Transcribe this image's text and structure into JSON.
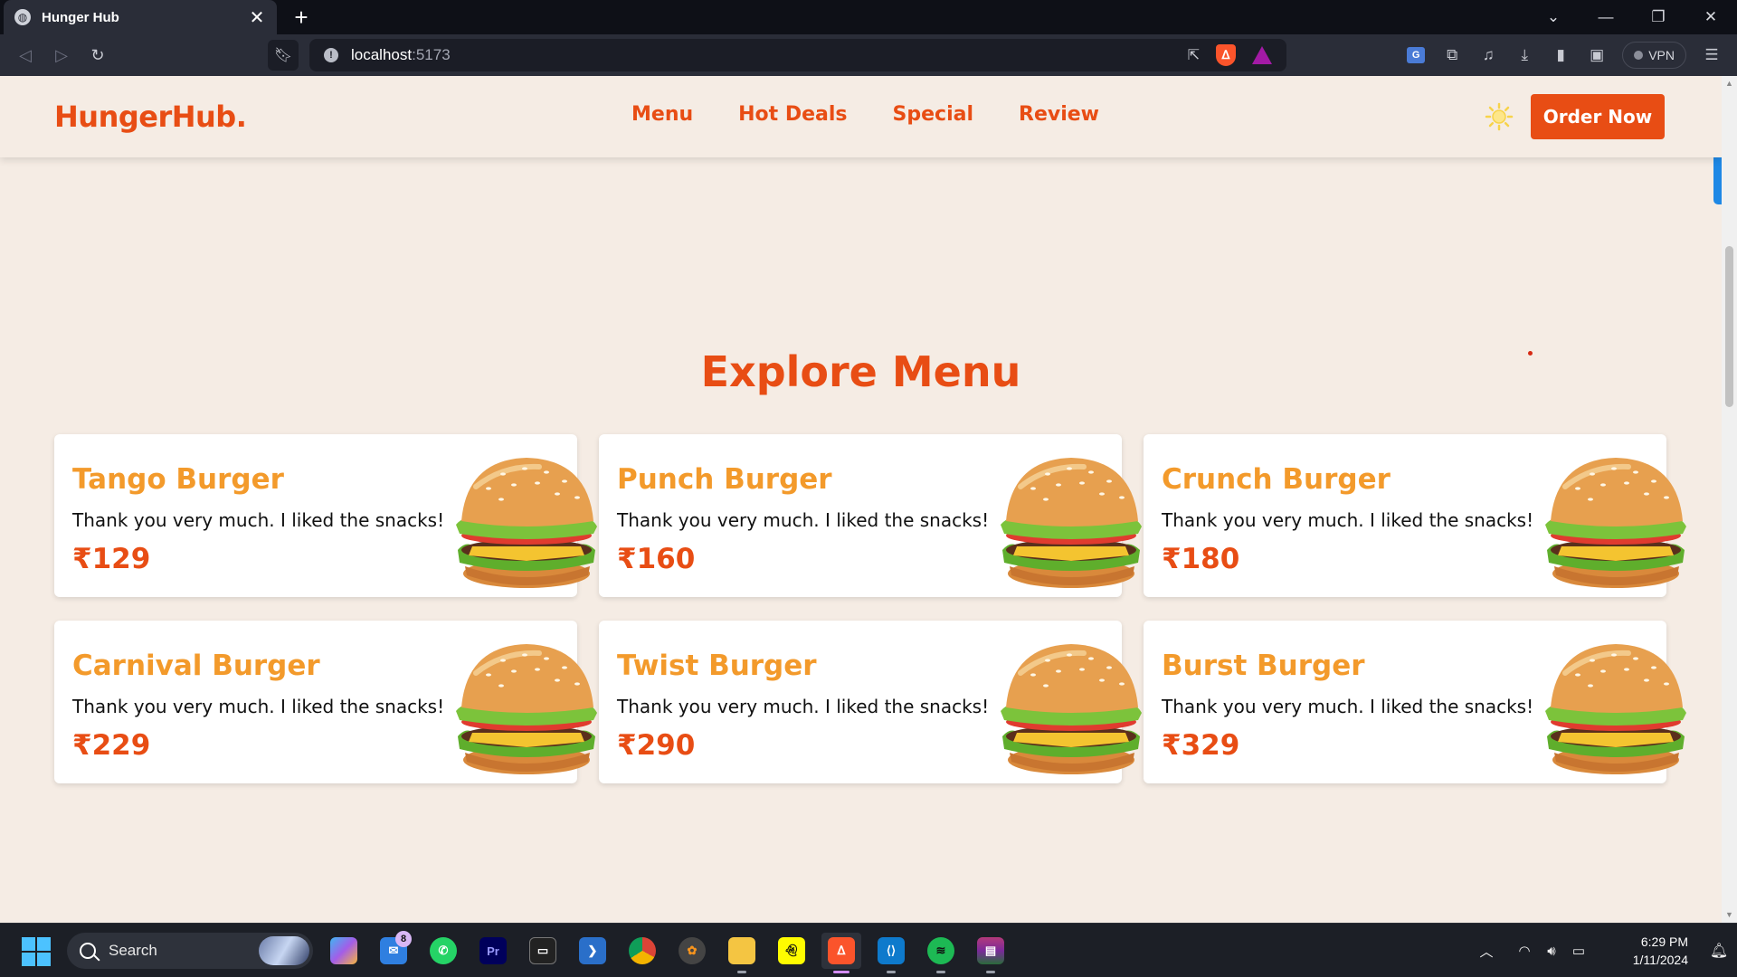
{
  "browser": {
    "tab_title": "Hunger Hub",
    "tab_close": "✕",
    "new_tab": "+",
    "url_host": "localhost",
    "url_port": ":5173",
    "vpn_label": "VPN"
  },
  "site": {
    "logo": "HungerHub.",
    "nav": [
      "Menu",
      "Hot Deals",
      "Special",
      "Review"
    ],
    "order_button": "Order Now"
  },
  "menu": {
    "title": "Explore Menu",
    "items": [
      {
        "name": "Tango Burger",
        "desc": "Thank you very much. I liked the snacks!",
        "price": "₹129"
      },
      {
        "name": "Punch Burger",
        "desc": "Thank you very much. I liked the snacks!",
        "price": "₹160"
      },
      {
        "name": "Crunch Burger",
        "desc": "Thank you very much. I liked the snacks!",
        "price": "₹180"
      },
      {
        "name": "Carnival Burger",
        "desc": "Thank you very much. I liked the snacks!",
        "price": "₹229"
      },
      {
        "name": "Twist Burger",
        "desc": "Thank you very much. I liked the snacks!",
        "price": "₹290"
      },
      {
        "name": "Burst Burger",
        "desc": "Thank you very much. I liked the snacks!",
        "price": "₹329"
      }
    ]
  },
  "taskbar": {
    "search_label": "Search",
    "mail_badge": "8",
    "time": "6:29 PM",
    "date": "1/11/2024"
  },
  "colors": {
    "brand": "#e84d14",
    "card_title": "#f39a2b",
    "page_bg": "#f5ece4"
  }
}
